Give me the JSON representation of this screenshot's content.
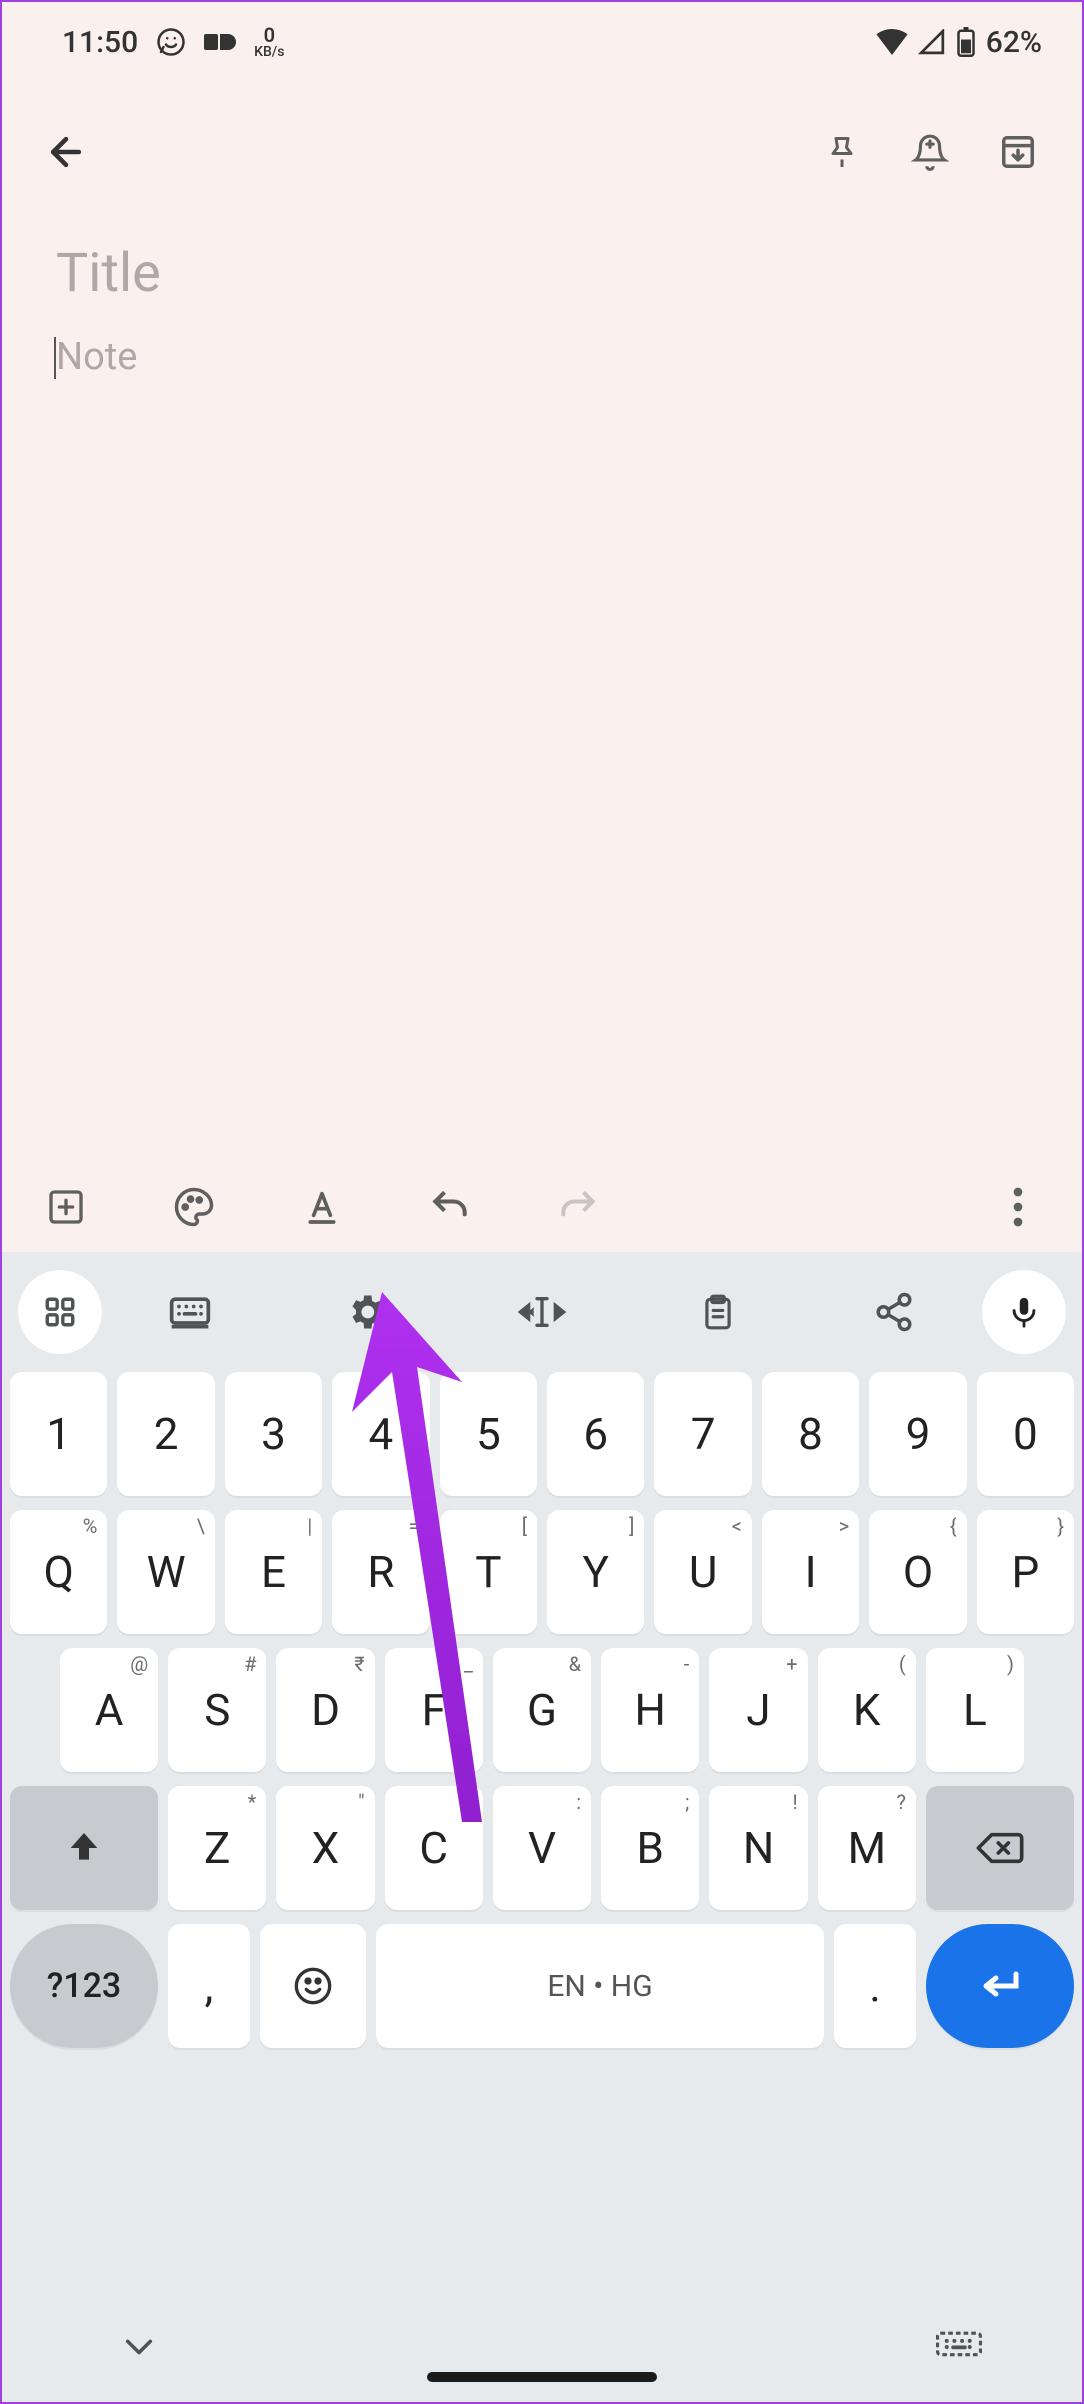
{
  "status": {
    "time": "11:50",
    "kbps_num": "0",
    "kbps_unit": "KB/s",
    "battery_pct": "62%"
  },
  "note": {
    "title_placeholder": "Title",
    "body_placeholder": "Note"
  },
  "keyboard": {
    "row_num": [
      "1",
      "2",
      "3",
      "4",
      "5",
      "6",
      "7",
      "8",
      "9",
      "0"
    ],
    "row1": [
      {
        "k": "Q",
        "h": "%"
      },
      {
        "k": "W",
        "h": "\\"
      },
      {
        "k": "E",
        "h": "|"
      },
      {
        "k": "R",
        "h": "="
      },
      {
        "k": "T",
        "h": "["
      },
      {
        "k": "Y",
        "h": "]"
      },
      {
        "k": "U",
        "h": "<"
      },
      {
        "k": "I",
        "h": ">"
      },
      {
        "k": "O",
        "h": "{"
      },
      {
        "k": "P",
        "h": "}"
      }
    ],
    "row2": [
      {
        "k": "A",
        "h": "@"
      },
      {
        "k": "S",
        "h": "#"
      },
      {
        "k": "D",
        "h": "₹"
      },
      {
        "k": "F",
        "h": "_"
      },
      {
        "k": "G",
        "h": "&"
      },
      {
        "k": "H",
        "h": "-"
      },
      {
        "k": "J",
        "h": "+"
      },
      {
        "k": "K",
        "h": "("
      },
      {
        "k": "L",
        "h": ")"
      }
    ],
    "row3": [
      {
        "k": "Z",
        "h": "*"
      },
      {
        "k": "X",
        "h": "\""
      },
      {
        "k": "C",
        "h": "'"
      },
      {
        "k": "V",
        "h": ":"
      },
      {
        "k": "B",
        "h": ";"
      },
      {
        "k": "N",
        "h": "!"
      },
      {
        "k": "M",
        "h": "?"
      }
    ],
    "sym_label": "?123",
    "comma": ",",
    "period": ".",
    "space_label": "EN • HG"
  }
}
